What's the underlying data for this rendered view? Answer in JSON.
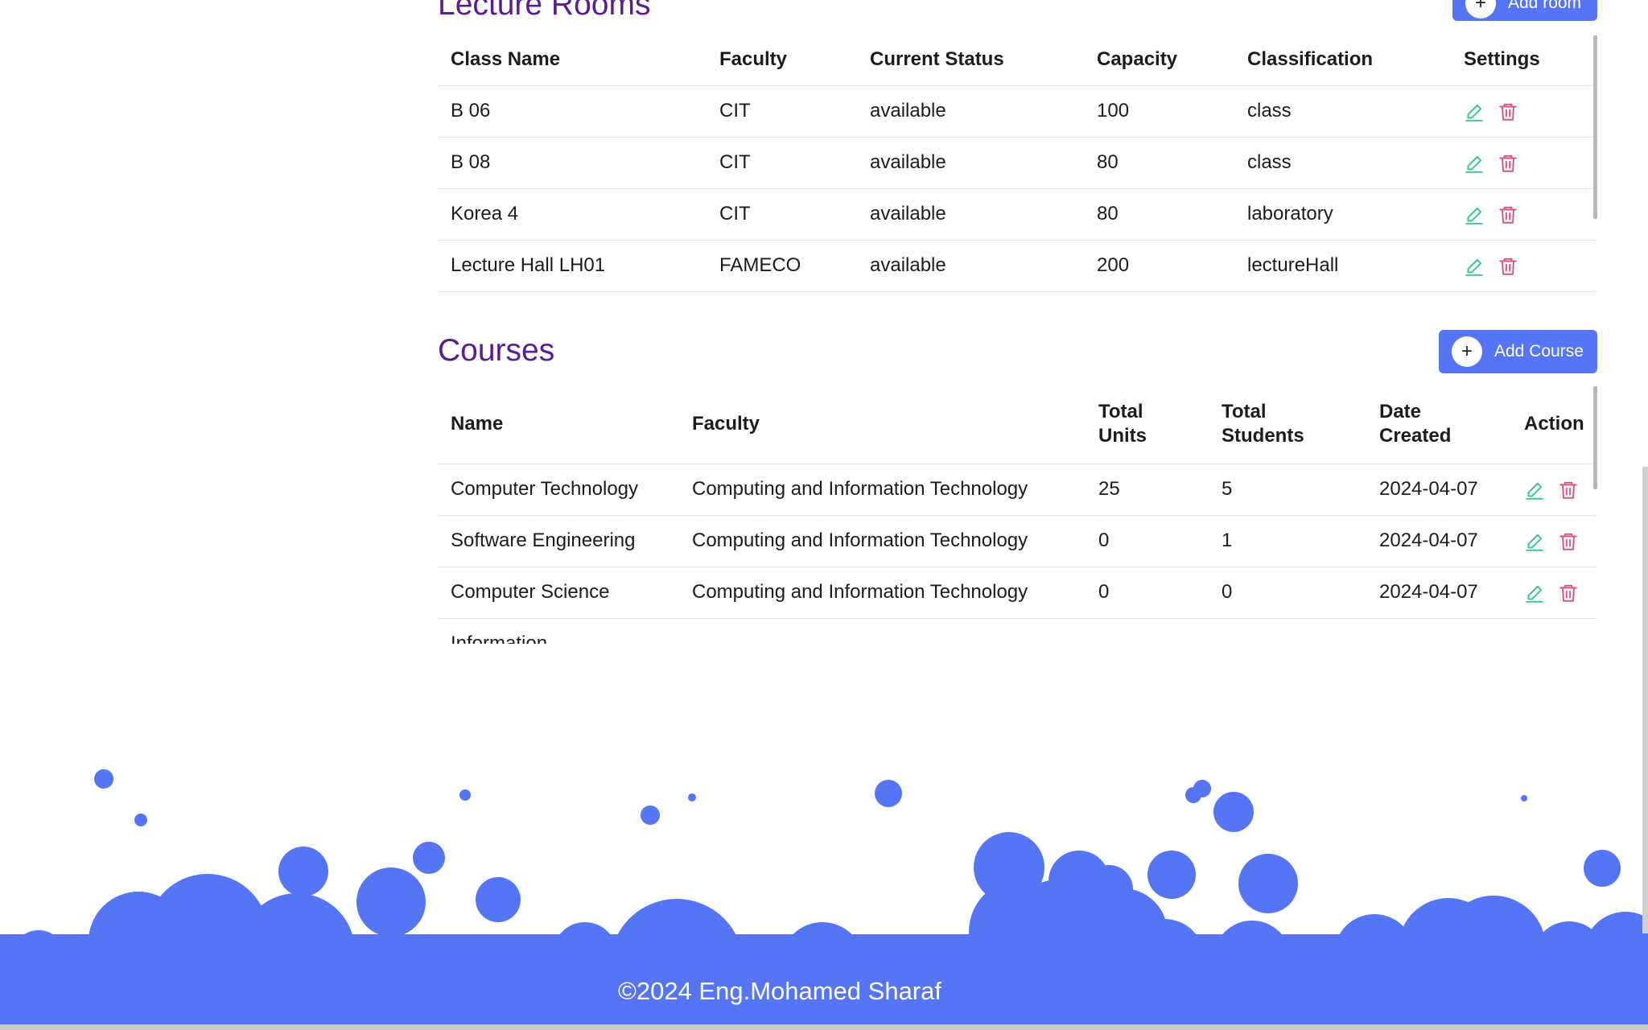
{
  "rooms": {
    "title": "Lecture Rooms",
    "add_label": "Add room",
    "columns": [
      "Class Name",
      "Faculty",
      "Current Status",
      "Capacity",
      "Classification",
      "Settings"
    ],
    "rows": [
      {
        "name": "B 06",
        "faculty": "CIT",
        "status": "available",
        "capacity": "100",
        "classification": "class"
      },
      {
        "name": "B 08",
        "faculty": "CIT",
        "status": "available",
        "capacity": "80",
        "classification": "class"
      },
      {
        "name": "Korea 4",
        "faculty": "CIT",
        "status": "available",
        "capacity": "80",
        "classification": "laboratory"
      },
      {
        "name": "Lecture Hall LH01",
        "faculty": "FAMECO",
        "status": "available",
        "capacity": "200",
        "classification": "lectureHall"
      }
    ]
  },
  "courses": {
    "title": "Courses",
    "add_label": "Add Course",
    "columns": [
      "Name",
      "Faculty",
      "Total Units",
      "Total Students",
      "Date Created",
      "Action"
    ],
    "rows": [
      {
        "name": "Computer Technology",
        "faculty": "Computing and Information Technology",
        "units": "25",
        "students": "5",
        "date": "2024-04-07"
      },
      {
        "name": "Software Engineering",
        "faculty": "Computing and Information Technology",
        "units": "0",
        "students": "1",
        "date": "2024-04-07"
      },
      {
        "name": "Computer Science",
        "faculty": "Computing and Information Technology",
        "units": "0",
        "students": "0",
        "date": "2024-04-07"
      },
      {
        "name": "Information",
        "faculty": "",
        "units": "",
        "students": "",
        "date": ""
      }
    ]
  },
  "footer": {
    "text": "©2024 Eng.Mohamed Sharaf"
  },
  "colors": {
    "accent": "#5575f5",
    "heading": "#5a1c8f",
    "edit_icon": "#3cc48a",
    "delete_icon": "#e0527a"
  },
  "icons": {
    "edit": "pencil-icon",
    "delete": "trash-icon",
    "add": "plus-icon"
  }
}
